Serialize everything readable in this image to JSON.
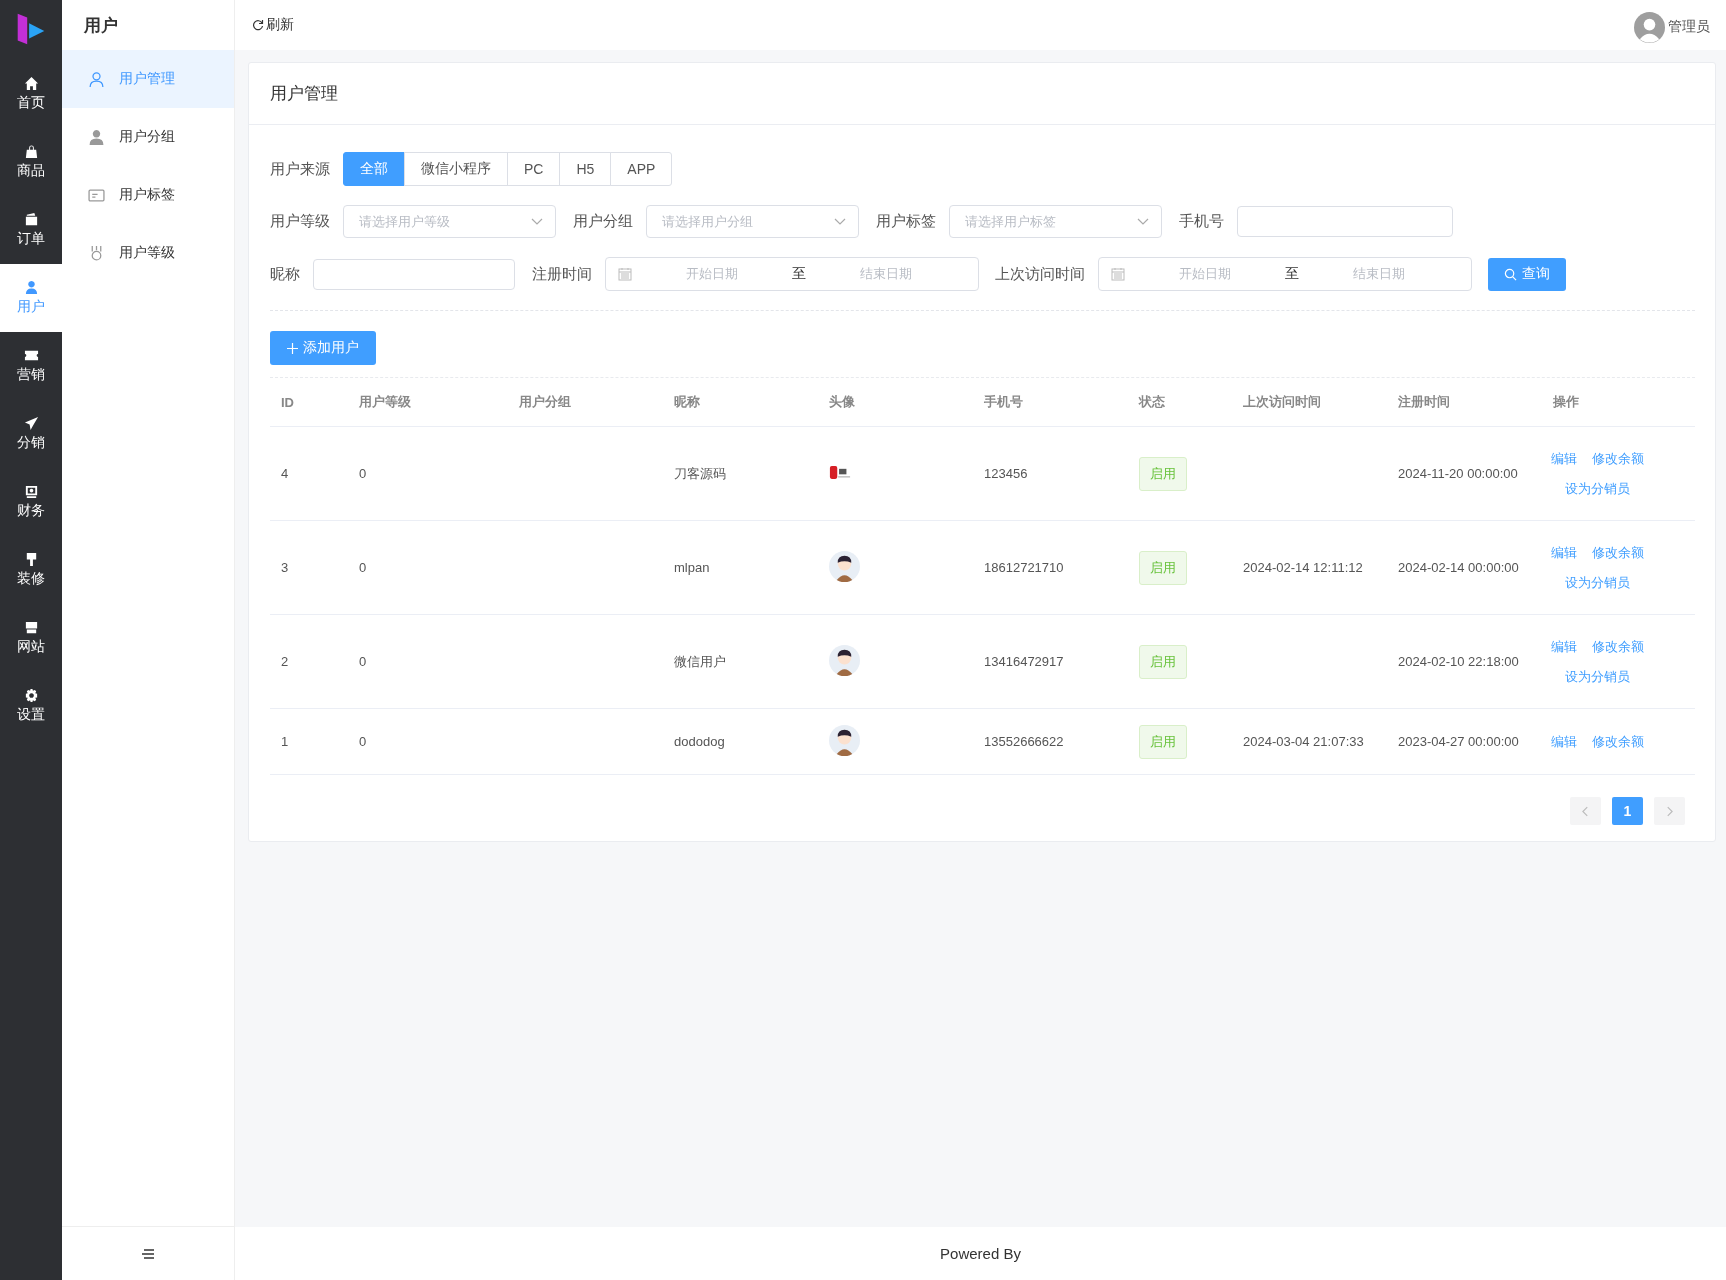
{
  "nav_rail": {
    "items": [
      {
        "label": "首页",
        "selected": false
      },
      {
        "label": "商品",
        "selected": false
      },
      {
        "label": "订单",
        "selected": false
      },
      {
        "label": "用户",
        "selected": true
      },
      {
        "label": "营销",
        "selected": false
      },
      {
        "label": "分销",
        "selected": false
      },
      {
        "label": "财务",
        "selected": false
      },
      {
        "label": "装修",
        "selected": false
      },
      {
        "label": "网站",
        "selected": false
      },
      {
        "label": "设置",
        "selected": false
      }
    ]
  },
  "sub_sidebar": {
    "title": "用户",
    "items": [
      {
        "label": "用户管理",
        "selected": true
      },
      {
        "label": "用户分组",
        "selected": false
      },
      {
        "label": "用户标签",
        "selected": false
      },
      {
        "label": "用户等级",
        "selected": false
      }
    ]
  },
  "top_bar": {
    "refresh": "刷新",
    "user": "管理员"
  },
  "card": {
    "title": "用户管理",
    "source": {
      "label": "用户来源",
      "options": [
        {
          "label": "全部",
          "selected": true
        },
        {
          "label": "微信小程序",
          "selected": false
        },
        {
          "label": "PC",
          "selected": false
        },
        {
          "label": "H5",
          "selected": false
        },
        {
          "label": "APP",
          "selected": false
        }
      ]
    },
    "filters": [
      {
        "kind": "select",
        "label": "用户等级",
        "placeholder": "请选择用户等级"
      },
      {
        "kind": "select",
        "label": "用户分组",
        "placeholder": "请选择用户分组"
      },
      {
        "kind": "select",
        "label": "用户标签",
        "placeholder": "请选择用户标签"
      },
      {
        "kind": "input",
        "label": "手机号"
      }
    ],
    "filters_2": [
      {
        "kind": "input",
        "label": "昵称"
      },
      {
        "kind": "daterange",
        "label": "注册时间",
        "start": "开始日期",
        "separator": "至",
        "end": "结束日期"
      },
      {
        "kind": "daterange",
        "label": "上次访问时间",
        "start": "开始日期",
        "separator": "至",
        "end": "结束日期"
      }
    ],
    "search_button": "查询",
    "add_button": "添加用户",
    "table": {
      "columns": [
        "ID",
        "用户等级",
        "用户分组",
        "昵称",
        "头像",
        "手机号",
        "状态",
        "上次访问时间",
        "注册时间",
        "操作"
      ],
      "rows": [
        {
          "id": "4",
          "level": "0",
          "nickname": "刀客源码",
          "phone": "123456",
          "status": "启用",
          "last_visit": "",
          "registered": "2024-11-20 00:00:00",
          "actions": [
            "编辑",
            "修改余额",
            "设为分销员"
          ]
        },
        {
          "id": "3",
          "level": "0",
          "nickname": "mlpan",
          "phone": "18612721710",
          "status": "启用",
          "last_visit": "2024-02-14 12:11:12",
          "registered": "2024-02-14 00:00:00",
          "actions": [
            "编辑",
            "修改余额",
            "设为分销员"
          ]
        },
        {
          "id": "2",
          "level": "0",
          "nickname": "微信用户",
          "phone": "13416472917",
          "status": "启用",
          "last_visit": "",
          "registered": "2024-02-10 22:18:00",
          "actions": [
            "编辑",
            "修改余额",
            "设为分销员"
          ]
        },
        {
          "id": "1",
          "level": "0",
          "nickname": "dododog",
          "phone": "13552666622",
          "status": "启用",
          "last_visit": "2024-03-04 21:07:33",
          "registered": "2023-04-27 00:00:00",
          "actions": [
            "编辑",
            "修改余额"
          ]
        }
      ]
    },
    "pagination": {
      "pages": [
        {
          "label": "1",
          "selected": true
        }
      ]
    }
  },
  "footer": "Powered By"
}
